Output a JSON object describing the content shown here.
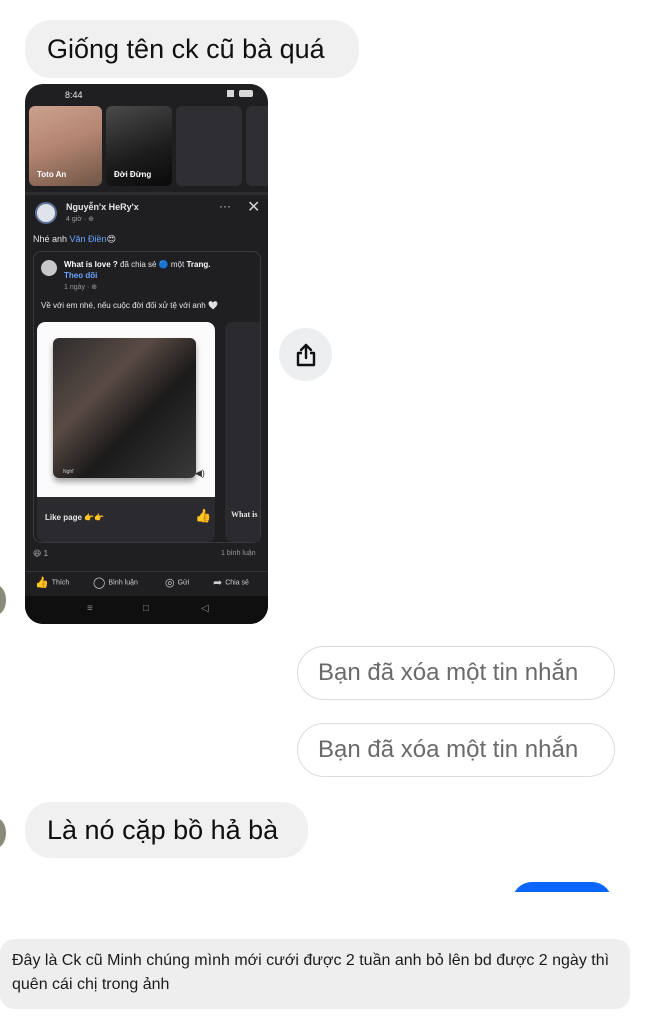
{
  "messages": {
    "m1": "Giống tên ck cũ bà quá",
    "deleted1": "Bạn đã xóa một tin nhắn",
    "deleted2": "Bạn đã xóa một tin nhắn",
    "m2": "Là nó cặp bồ hả bà"
  },
  "screenshot": {
    "status_time": "8:44",
    "stories": [
      {
        "label": "Toto An"
      },
      {
        "label": "Đời Đừng"
      }
    ],
    "post": {
      "author": "Nguyễn'x HeRy'x",
      "time": "4 giờ · ⊕",
      "text_prefix": "Nhé anh ",
      "mention": "Văn Điền",
      "emoji": "😍"
    },
    "shared": {
      "title_bold": "What is ",
      "title_love": "love ?",
      "title_rest": " đã chia sẻ 🔵 một ",
      "title_page": "Trang.",
      "follow": "Theo dõi",
      "time": "1 ngày · ⊕",
      "text": "Về với em nhé, nếu cuộc đời đối xử tệ với anh 🤍",
      "image_sign": "Nghĩ",
      "like_page": "Like page 👉👉",
      "card2_title": "What is lov"
    },
    "reactions": "😆 1",
    "comments": "1 bình luận",
    "actions": [
      "Thích",
      "Bình luận",
      "Gửi",
      "Chia sẻ"
    ]
  },
  "caption": "Đây là Ck cũ Minh chúng mình mới cưới được 2 tuần anh bỏ lên bd được 2 ngày thì quên cái chị trong ảnh",
  "icons": {
    "share": "share-icon",
    "close": "close-icon",
    "more": "more-dots-icon"
  },
  "colors": {
    "accent_blue": "#0a66ff",
    "bubble_gray": "#f0f0f0",
    "phone_dark": "#1f1f22"
  }
}
